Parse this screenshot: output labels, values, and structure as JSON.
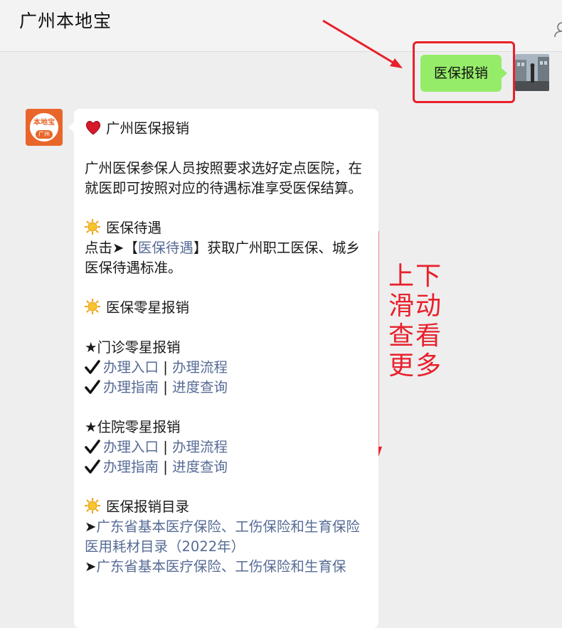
{
  "header": {
    "title": "广州本地宝"
  },
  "outgoing": {
    "text": "医保报销"
  },
  "message": {
    "title": "广州医保报销",
    "intro": "广州医保参保人员按照要求选好定点医院，在就医即可按照对应的待遇标准享受医保结算。",
    "section1_title": "医保待遇",
    "section1_prefix": "点击➤【",
    "section1_link": "医保待遇",
    "section1_suffix": "】获取广州职工医保、城乡医保待遇标准。",
    "section2_title": "医保零星报销",
    "outpatient_title": "★门诊零星报销",
    "outpatient_link1": "办理入口",
    "outpatient_link2": "办理流程",
    "outpatient_link3": "办理指南",
    "outpatient_link4": "进度查询",
    "inpatient_title": "★住院零星报销",
    "inpatient_link1": "办理入口",
    "inpatient_link2": "办理流程",
    "inpatient_link3": "办理指南",
    "inpatient_link4": "进度查询",
    "sep": "|",
    "section3_title": "医保报销目录",
    "catalog1": "广东省基本医疗保险、工伤保险和生育保险医用耗材目录（2022年）",
    "catalog2": "广东省基本医疗保险、工伤保险和生育保"
  },
  "annotation": {
    "line1": "上下",
    "line2": "滑动",
    "line3": "查看",
    "line4": "更多"
  },
  "bot_avatar": {
    "logo": "本地宝",
    "city": "广州"
  },
  "colors": {
    "accent_red": "#e8202b",
    "bubble_green": "#95ec69",
    "link": "#566b95"
  }
}
